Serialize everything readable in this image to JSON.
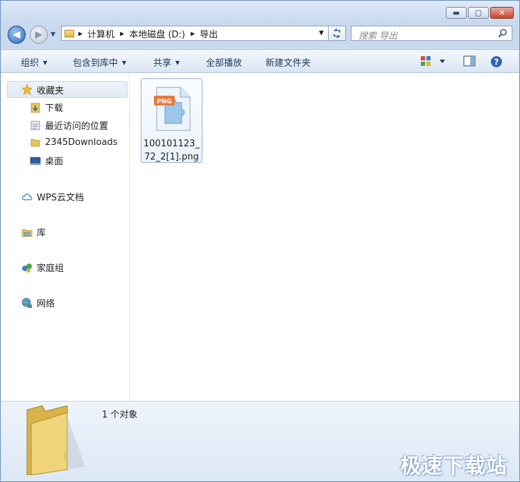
{
  "window": {
    "controls": {
      "minimize": "▬",
      "maximize": "▢",
      "close": "✕"
    }
  },
  "navigation": {
    "back_glyph": "◀",
    "forward_glyph": "▶",
    "address": {
      "crumbs": [
        "计算机",
        "本地磁盘 (D:)",
        "导出"
      ]
    },
    "search": {
      "placeholder": "搜索 导出"
    }
  },
  "toolbar": {
    "organize": "组织",
    "include_in_library": "包含到库中",
    "share": "共享",
    "play_all": "全部播放",
    "new_folder": "新建文件夹"
  },
  "sidebar": {
    "favorites": {
      "label": "收藏夹",
      "items": [
        "下载",
        "最近访问的位置",
        "2345Downloads",
        "桌面"
      ]
    },
    "wps_cloud": "WPS云文档",
    "libraries": "库",
    "homegroup": "家庭组",
    "network": "网络"
  },
  "files": [
    {
      "name": "100101123_72_2[1].png",
      "type_badge": "PNG"
    }
  ],
  "details": {
    "object_count": "1 个对象"
  },
  "watermark": "极速下载站",
  "colors": {
    "accent": "#2c66c2",
    "folder_yellow": "#e8c55a",
    "png_badge": "#e6793b"
  }
}
